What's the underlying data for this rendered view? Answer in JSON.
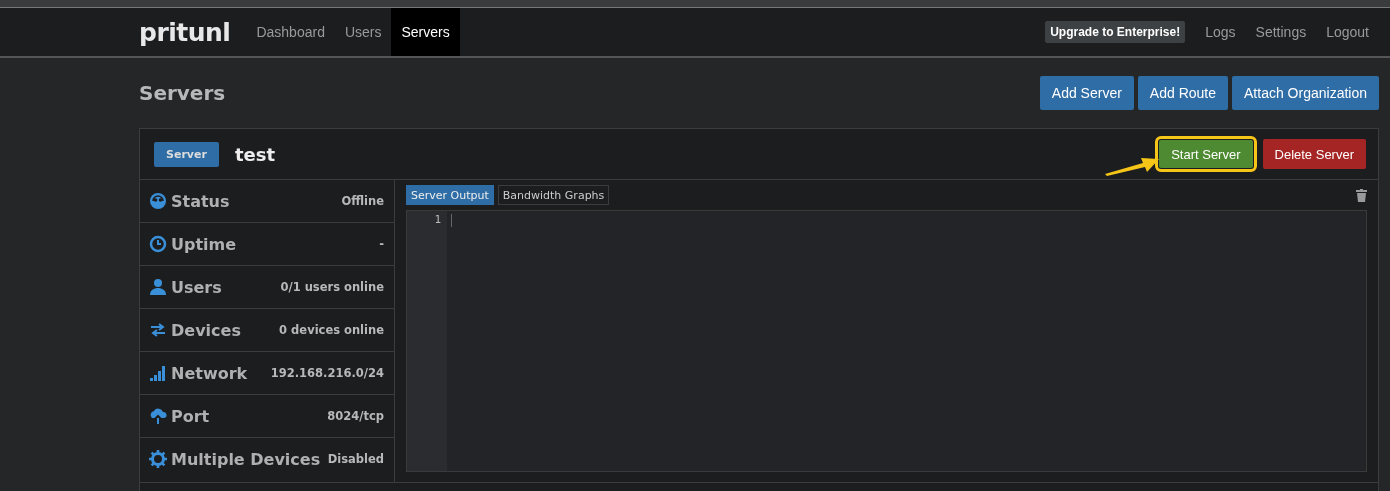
{
  "navbar": {
    "brand": "pritunl",
    "links": [
      {
        "label": "Dashboard",
        "selected": false
      },
      {
        "label": "Users",
        "selected": false
      },
      {
        "label": "Servers",
        "selected": true
      }
    ],
    "upgrade": "Upgrade to Enterprise!",
    "right_links": [
      "Logs",
      "Settings",
      "Logout"
    ]
  },
  "page": {
    "title": "Servers",
    "buttons": [
      "Add Server",
      "Add Route",
      "Attach Organization"
    ]
  },
  "server": {
    "badge": "Server",
    "name": "test",
    "start_button": {
      "label": "Start Server",
      "highlighted": true
    },
    "delete_button": "Delete Server",
    "stats": [
      {
        "label": "Status",
        "value": "Offline"
      },
      {
        "label": "Uptime",
        "value": "-"
      },
      {
        "label": "Users",
        "value": "0/1 users online"
      },
      {
        "label": "Devices",
        "value": "0 devices online"
      },
      {
        "label": "Network",
        "value": "192.168.216.0/24"
      },
      {
        "label": "Port",
        "value": "8024/tcp"
      },
      {
        "label": "Multiple Devices",
        "value": "Disabled"
      }
    ],
    "tabs": [
      {
        "label": "Server Output",
        "selected": true
      },
      {
        "label": "Bandwidth Graphs",
        "selected": false
      }
    ],
    "output": {
      "line_numbers": [
        "1"
      ]
    }
  }
}
